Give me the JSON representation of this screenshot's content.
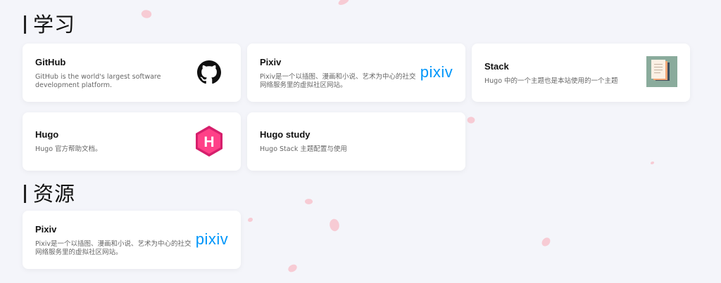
{
  "sections": [
    {
      "title": "学习"
    },
    {
      "title": "资源"
    }
  ],
  "cards": [
    {
      "title": "GitHub",
      "desc": "GitHub is the world's largest software development platform.",
      "icon": "github-icon"
    },
    {
      "title": "Pixiv",
      "desc": "Pixiv是一个以插图、漫画和小说、艺术为中心的社交网络服务里的虚拟社区网站。",
      "icon": "pixiv-logo",
      "logo_text": "pixiv"
    },
    {
      "title": "Stack",
      "desc": "Hugo 中的一个主题也是本站使用的一个主题",
      "icon": "stack-theme-icon"
    },
    {
      "title": "Hugo",
      "desc": "Hugo 官方帮助文档。",
      "icon": "hugo-icon",
      "logo_letter": "H"
    },
    {
      "title": "Hugo study",
      "desc": "Hugo Stack 主题配置与使用"
    },
    {
      "title": "Pixiv",
      "desc": "Pixiv是一个以插图、漫画和小说、艺术为中心的社交网络服务里的虚拟社区网站。",
      "icon": "pixiv-logo",
      "logo_text": "pixiv"
    }
  ],
  "colors": {
    "background": "#f4f5fa",
    "pixiv_blue": "#0096fa",
    "hugo_pink": "#ff4088",
    "petal": "#f7c6cf"
  }
}
